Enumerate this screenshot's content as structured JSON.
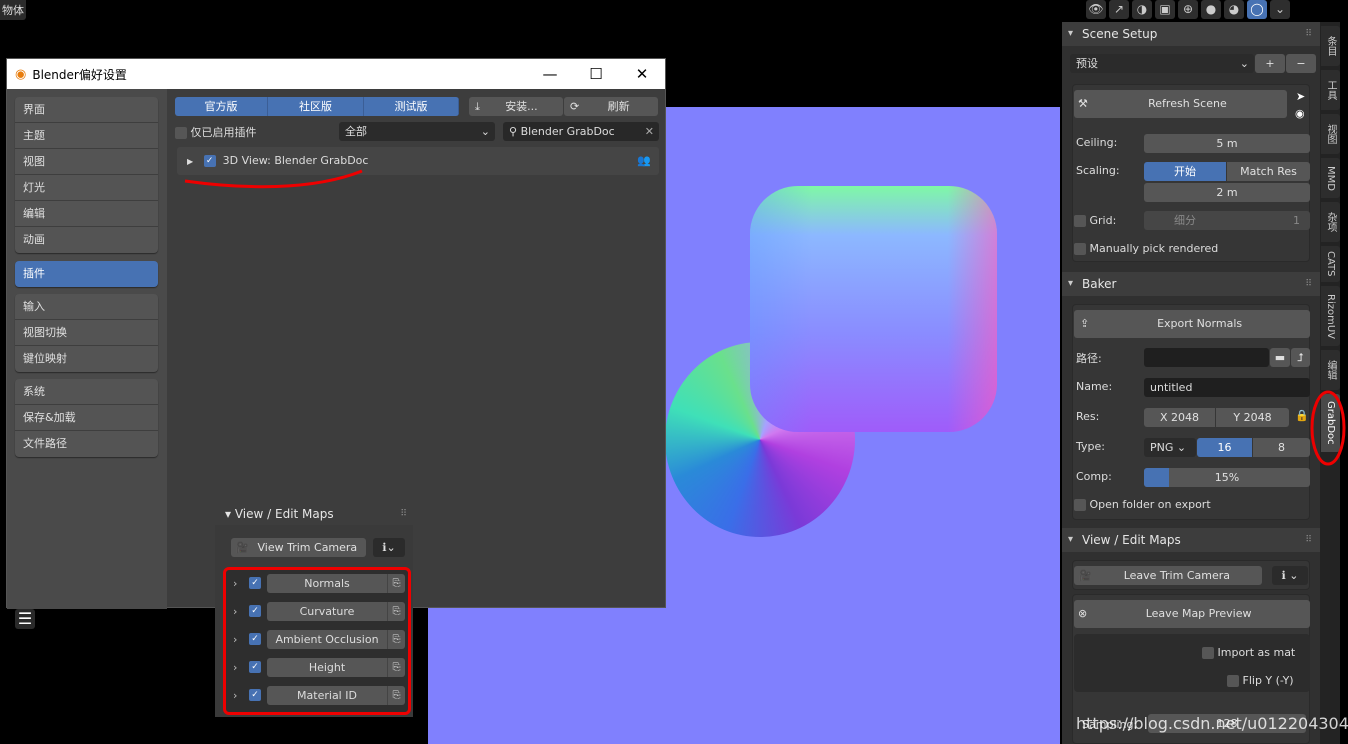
{
  "viewport": {
    "object_label": "物体",
    "background": "#8080fe"
  },
  "header_icons": [
    "visibility-icon",
    "gizmo-icon",
    "overlay-icon",
    "xray-icon",
    "wireframe-shading-icon",
    "solid-shading-icon",
    "material-shading-icon",
    "rendered-shading-icon"
  ],
  "prefs": {
    "title": "Blender偏好设置",
    "sidebar": {
      "group1": [
        "界面",
        "主题",
        "视图",
        "灯光",
        "编辑",
        "动画"
      ],
      "group2": [
        "插件"
      ],
      "group3": [
        "输入",
        "视图切换",
        "键位映射"
      ],
      "group4": [
        "系统",
        "保存&加载",
        "文件路径"
      ]
    },
    "tabs": [
      "官方版",
      "社区版",
      "测试版"
    ],
    "install": "安装...",
    "refresh": "刷新",
    "enabled_only": "仅已启用插件",
    "category": "全部",
    "search": "Blender GrabDoc",
    "addon": "3D View: Blender GrabDoc"
  },
  "float_panel": {
    "title": "View / Edit Maps",
    "camera_button": "View Trim Camera",
    "maps": [
      "Normals",
      "Curvature",
      "Ambient Occlusion",
      "Height",
      "Material ID"
    ]
  },
  "side_panel": {
    "scene_setup": {
      "title": "Scene Setup",
      "preset": "预设",
      "refresh": "Refresh Scene",
      "ceiling_label": "Ceiling:",
      "ceiling": "5 m",
      "scaling_label": "Scaling:",
      "scaling_on": "开始",
      "scaling_match": "Match Res",
      "scaling_value": "2 m",
      "grid_label": "Grid:",
      "grid_sub": "细分",
      "grid_value": "1",
      "manual": "Manually pick rendered"
    },
    "baker": {
      "title": "Baker",
      "export": "Export Normals",
      "path_label": "路径:",
      "path": "",
      "name_label": "Name:",
      "name": "untitled",
      "res_label": "Res:",
      "res_x": "X  2048",
      "res_y": "Y  2048",
      "type_label": "Type:",
      "type": "PNG",
      "depth_16": "16",
      "depth_8": "8",
      "comp_label": "Comp:",
      "comp": "15%",
      "comp_fraction": 0.15,
      "open_folder": "Open folder on export"
    },
    "view_edit": {
      "title": "View / Edit Maps",
      "leave_camera": "Leave Trim Camera",
      "leave_preview": "Leave Map Preview",
      "import_mat": "Import as mat",
      "flip_y": "Flip Y (-Y)",
      "sampling_label": "Sampling:",
      "sampling": "128"
    }
  },
  "vertical_tabs": [
    "条目",
    "工具",
    "视图",
    "MMD",
    "杂项",
    "CATS",
    "RizomUV",
    "编辑",
    "GrabDoc"
  ],
  "watermark": "https://blog.csdn.net/u012204304",
  "accent": "#4772b3"
}
